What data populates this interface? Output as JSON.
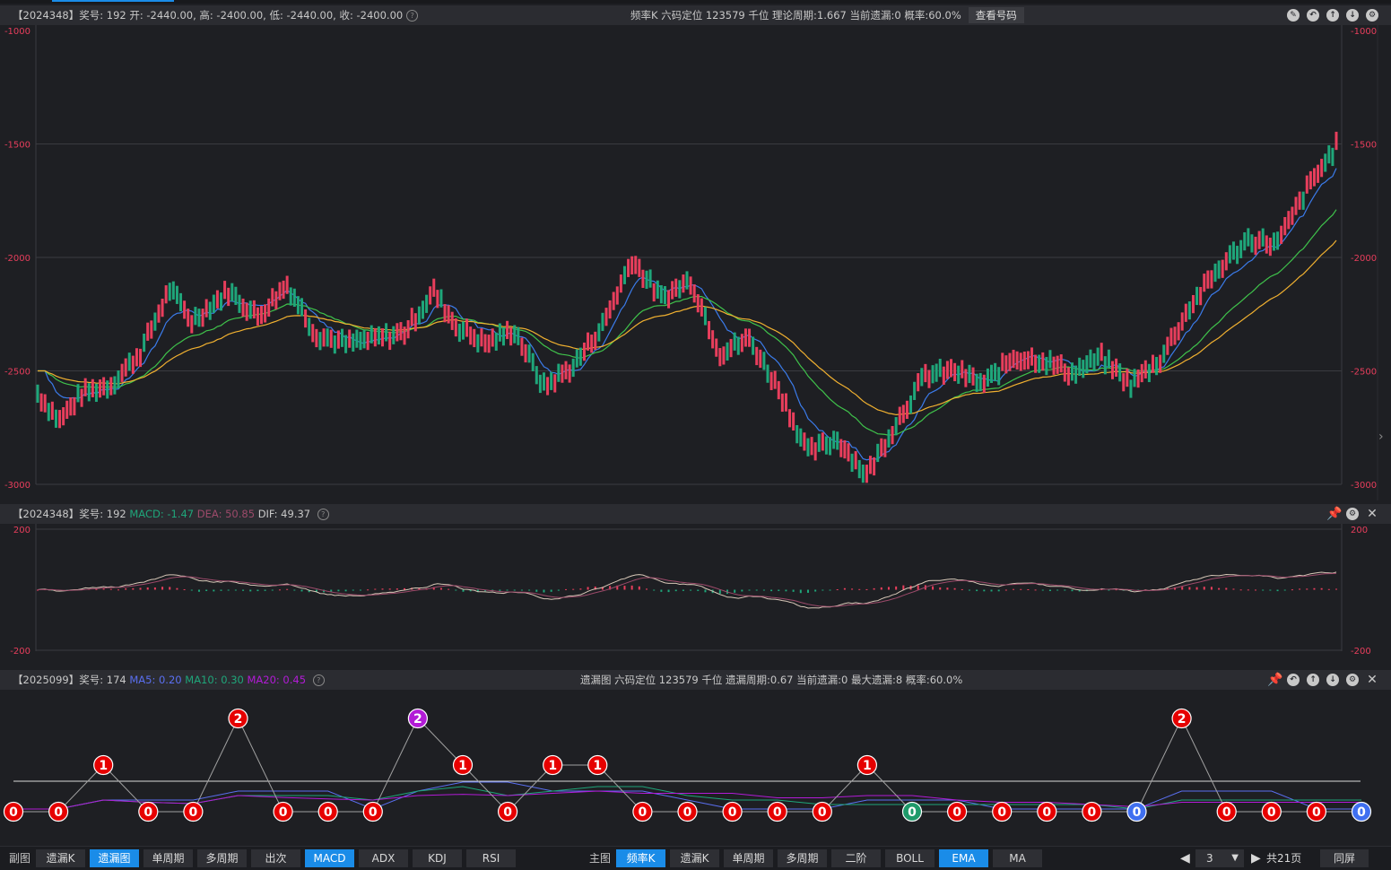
{
  "main_header": {
    "info": "【2024348】奖号: 192  开: -2440.00, 高: -2400.00, 低: -2440.00, 收: -2400.00",
    "center": "频率K   六码定位   123579   千位   理论周期:1.667   当前遗漏:0   概率:60.0%",
    "chip": "查看号码"
  },
  "main_axis": {
    "ticks": [
      "-1000",
      "-1500",
      "-2000",
      "-2500",
      "-3000"
    ]
  },
  "macd_header": {
    "prefix": "【2024348】奖号: 192",
    "macd": "MACD: -1.47",
    "dea": "DEA: 50.85",
    "dif": "DIF: 49.37"
  },
  "macd_axis": {
    "ticks": [
      "200",
      "-200"
    ]
  },
  "omission_header": {
    "prefix": "【2025099】奖号: 174",
    "ma5": "MA5: 0.20",
    "ma10": "MA10: 0.30",
    "ma20": "MA20: 0.45",
    "center": "遗漏图   六码定位   123579   千位   遗漏周期:0.67   当前遗漏:0   最大遗漏:8   概率:60.0%"
  },
  "omission_nodes": [
    "0",
    "0",
    "1",
    "0",
    "0",
    "2",
    "0",
    "0",
    "0",
    "2",
    "1",
    "0",
    "1",
    "1",
    "0",
    "0",
    "0",
    "0",
    "0",
    "1",
    "0",
    "0",
    "0",
    "0",
    "0",
    "0",
    "2",
    "0",
    "0",
    "0",
    "0"
  ],
  "colors": {
    "up": "#e83e5c",
    "down": "#1fa67a",
    "ema1": "#3b7bea",
    "ema2": "#3fc24b",
    "ema3": "#f0b030",
    "accent": "#1a8ce8",
    "node_red": "#e60000",
    "node_purple": "#b21bd6",
    "node_green": "#1f9a6a",
    "node_blue": "#3f6ff0"
  },
  "toolbar": {
    "sub_label": "副图",
    "sub_buttons": [
      "遗漏K",
      "遗漏图",
      "单周期",
      "多周期",
      "出次",
      "MACD",
      "ADX",
      "KDJ",
      "RSI"
    ],
    "main_label": "主图",
    "main_buttons": [
      "频率K",
      "遗漏K",
      "单周期",
      "多周期",
      "二阶",
      "BOLL",
      "EMA",
      "MA"
    ],
    "page_value": "3",
    "page_total": "共21页",
    "sync": "同屏"
  }
}
